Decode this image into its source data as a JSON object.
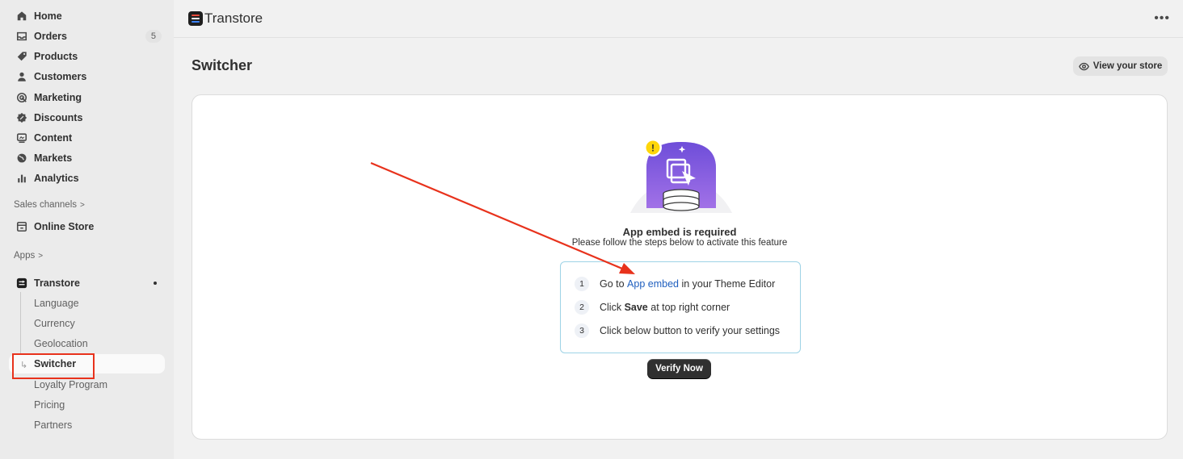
{
  "sidebar": {
    "main_items": [
      {
        "label": "Home",
        "icon": "home-icon"
      },
      {
        "label": "Orders",
        "icon": "orders-icon",
        "badge": "5"
      },
      {
        "label": "Products",
        "icon": "tag-icon"
      },
      {
        "label": "Customers",
        "icon": "person-icon"
      },
      {
        "label": "Marketing",
        "icon": "target-icon"
      },
      {
        "label": "Discounts",
        "icon": "discount-icon"
      },
      {
        "label": "Content",
        "icon": "content-icon"
      },
      {
        "label": "Markets",
        "icon": "globe-icon"
      },
      {
        "label": "Analytics",
        "icon": "bar-chart-icon"
      }
    ],
    "sales_channels_label": "Sales channels",
    "online_store_label": "Online Store",
    "apps_label": "Apps",
    "app_label": "Transtore",
    "app_sub_items": [
      "Language",
      "Currency",
      "Geolocation",
      "Switcher",
      "Loyalty Program",
      "Pricing",
      "Partners"
    ],
    "active_sub_item": "Switcher"
  },
  "header": {
    "app_name": "Transtore",
    "more_label": "•••"
  },
  "page": {
    "title": "Switcher",
    "view_store_label": "View your store"
  },
  "card": {
    "title": "App embed is required",
    "subtitle": "Please follow the steps below to activate this feature",
    "steps": [
      {
        "num": "1",
        "prefix": "Go to ",
        "link": "App embed",
        "suffix": " in your Theme Editor"
      },
      {
        "num": "2",
        "prefix": "Click ",
        "bold": "Save",
        "suffix": " at top right corner"
      },
      {
        "num": "3",
        "prefix": "Click below button to verify your settings"
      }
    ],
    "verify_label": "Verify Now",
    "warning_glyph": "!"
  },
  "colors": {
    "annotation": "#e8321c",
    "link": "#1f5fbf",
    "illustration_purple": "#7b5ce6",
    "warning_yellow": "#ffd60a"
  }
}
